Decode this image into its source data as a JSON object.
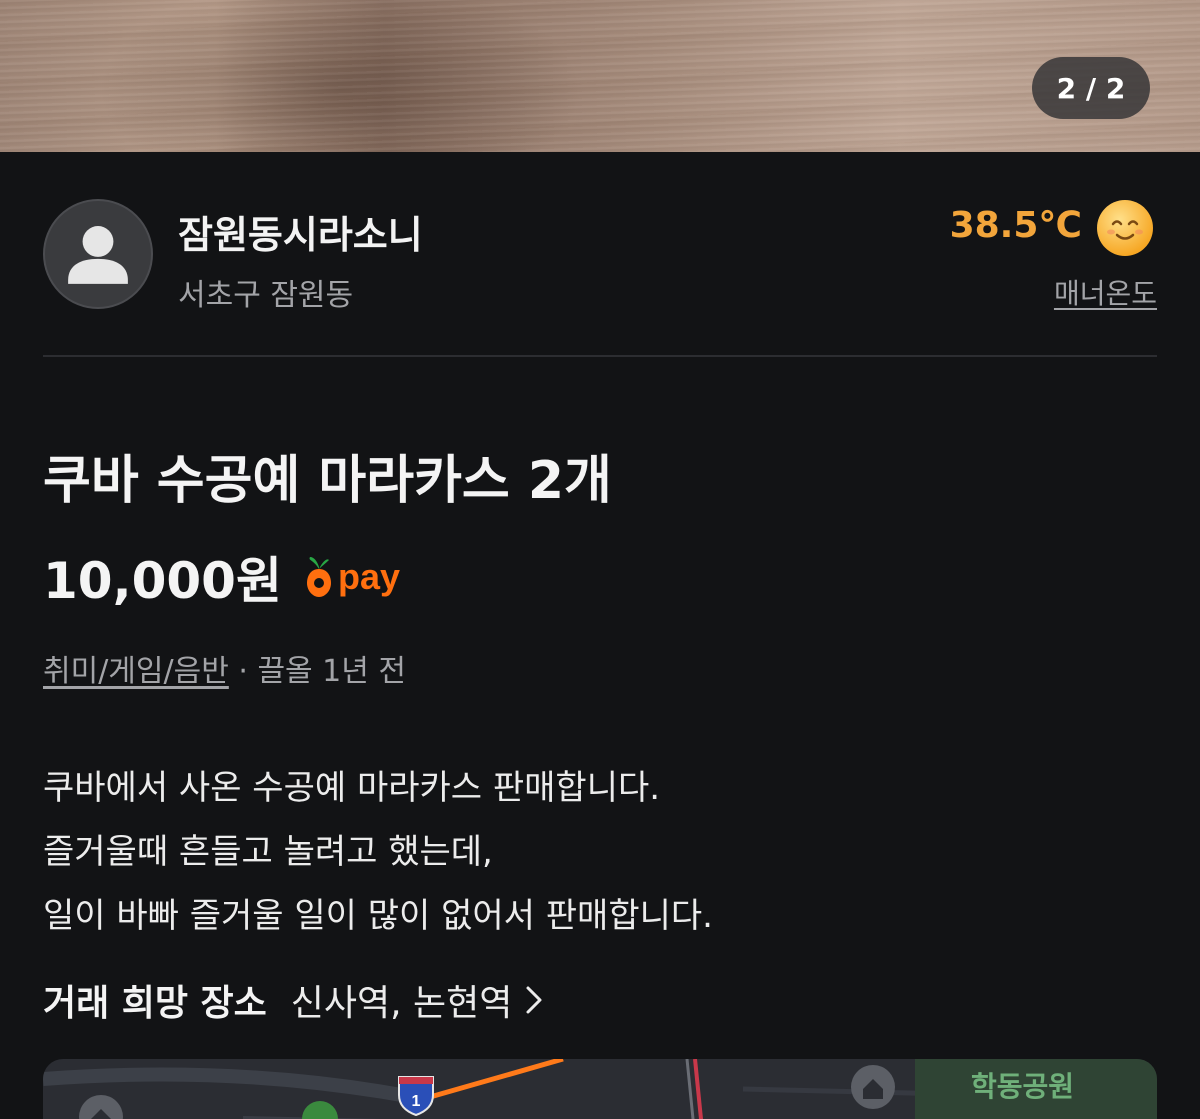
{
  "photo": {
    "counter": "2 / 2"
  },
  "seller": {
    "name": "잠원동시라소니",
    "location": "서초구 잠원동",
    "temperature": "38.5℃",
    "manner_label": "매너온도",
    "avatar_icon": "default-user-avatar",
    "face_icon": "smiling-face-icon"
  },
  "product": {
    "title": "쿠바 수공예 마라카스 2개",
    "price": "10,000원",
    "pay_label": "pay",
    "category": "취미/게임/음반",
    "separator": " · ",
    "time": "끌올 1년 전",
    "description": [
      "쿠바에서 사온 수공예 마라카스 판매합니다.",
      "즐거울때 흔들고 놀려고 했는데,",
      "일이 바빠 즐거울 일이 많이 없어서 판매합니다."
    ]
  },
  "trade": {
    "label": "거래 희망 장소",
    "place": "신사역, 논현역"
  },
  "map": {
    "park_label": "학동공원",
    "route_sign": "1"
  },
  "colors": {
    "background": "#121315",
    "accent_orange": "#ff6f0f",
    "temperature": "#f2a53b",
    "muted_text": "#a3a4a8"
  }
}
